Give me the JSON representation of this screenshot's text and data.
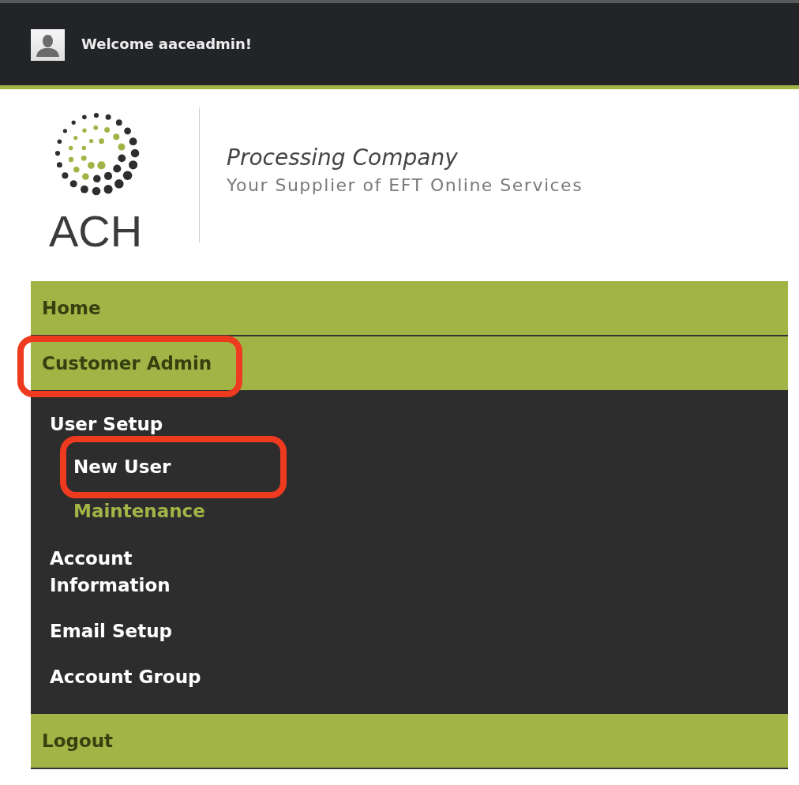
{
  "header": {
    "welcome": "Welcome aaceadmin!"
  },
  "brand": {
    "logo_text": "ACH",
    "title": "Processing Company",
    "tagline": "Your Supplier of EFT Online Services"
  },
  "nav": {
    "items": [
      {
        "label": "Home",
        "expanded": false,
        "highlighted": false
      },
      {
        "label": "Customer Admin",
        "expanded": true,
        "highlighted": true,
        "children": [
          {
            "label": "User Setup",
            "selected": false,
            "highlighted": false,
            "children": [
              {
                "label": "New User",
                "selected": false,
                "highlighted": true
              },
              {
                "label": "Maintenance",
                "selected": true,
                "highlighted": false
              }
            ]
          },
          {
            "label": "Account Information",
            "selected": false,
            "highlighted": false
          },
          {
            "label": "Email Setup",
            "selected": false,
            "highlighted": false
          },
          {
            "label": "Account Group",
            "selected": false,
            "highlighted": false
          }
        ]
      },
      {
        "label": "Logout",
        "expanded": false,
        "highlighted": false
      }
    ]
  }
}
